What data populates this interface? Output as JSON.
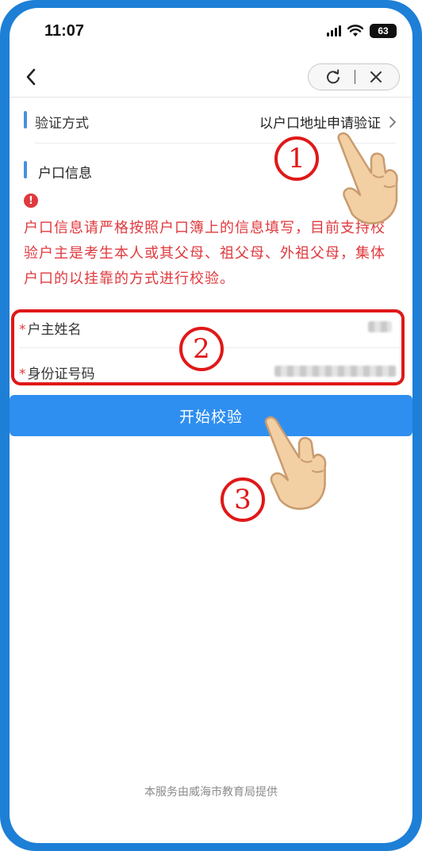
{
  "status_bar": {
    "time": "11:07",
    "battery": "63"
  },
  "verification": {
    "label": "验证方式",
    "value": "以户口地址申请验证"
  },
  "household_section": {
    "title": "户口信息"
  },
  "notice": {
    "text": "户口信息请严格按照户口簿上的信息填写，目前支持校验户主是考生本人或其父母、祖父母、外祖父母，集体户口的以挂靠的方式进行校验。"
  },
  "form": {
    "required_mark": "*",
    "householder_name_label": "户主姓名",
    "id_number_label": "身份证号码"
  },
  "submit_label": "开始校验",
  "footer": "本服务由威海市教育局提供",
  "annotations": {
    "step1": "1",
    "step2": "2",
    "step3": "3"
  },
  "colors": {
    "accent": "#2f8ff0",
    "warning": "#e0393e",
    "annotation": "#e01818",
    "frame": "#1d7fd6"
  },
  "icons": [
    "back-chevron-icon",
    "refresh-icon",
    "close-icon",
    "chevron-right-icon",
    "warning-icon",
    "wifi-icon",
    "signal-icon",
    "pointing-hand-icon"
  ]
}
